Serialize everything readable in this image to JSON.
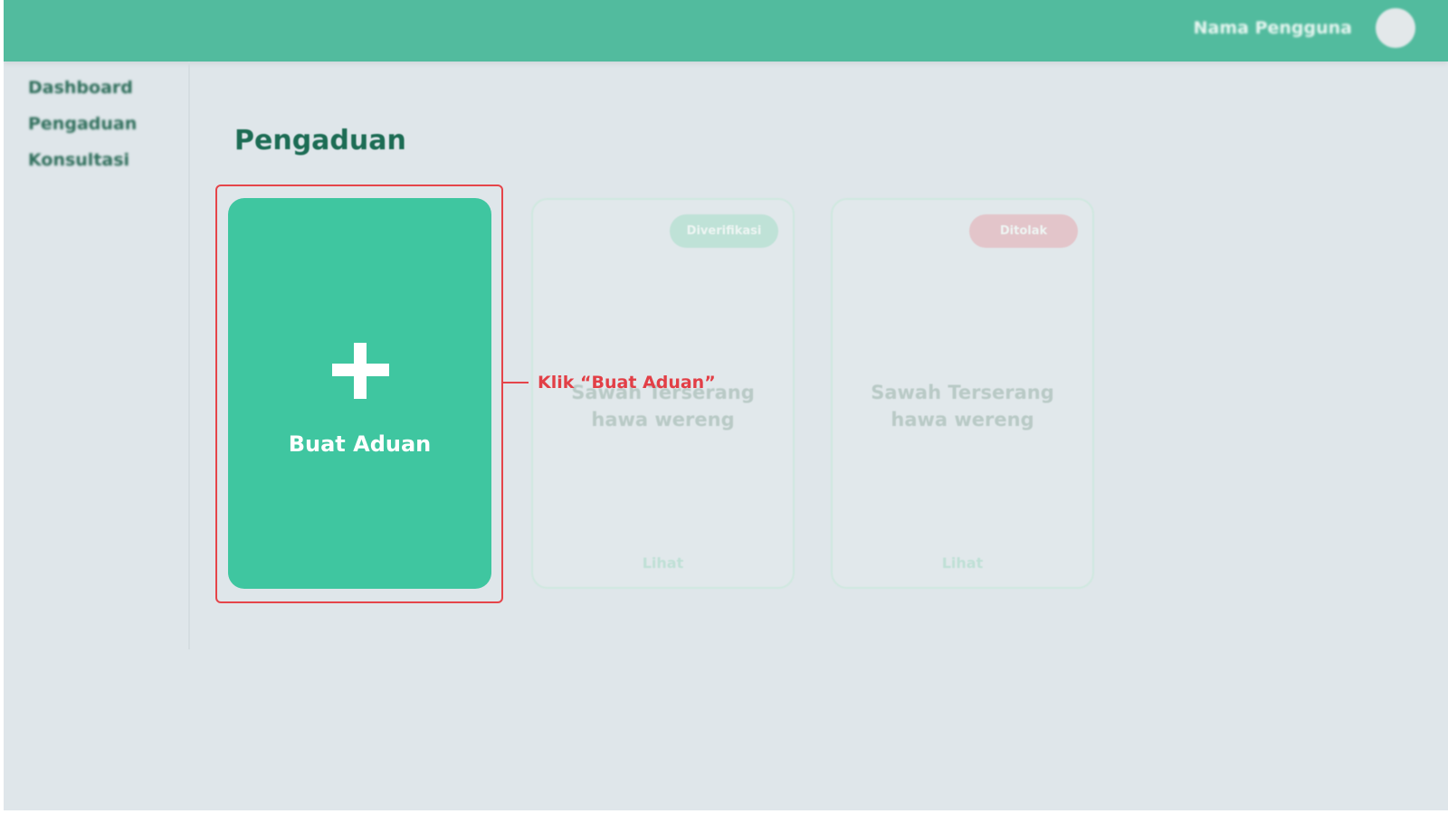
{
  "header": {
    "user_name": "Nama Pengguna",
    "avatar_icon": "user-avatar-icon"
  },
  "sidebar": {
    "items": [
      {
        "label": "Dashboard"
      },
      {
        "label": "Pengaduan"
      },
      {
        "label": "Konsultasi"
      }
    ]
  },
  "main": {
    "title": "Pengaduan",
    "create_card": {
      "icon": "plus-icon",
      "label": "Buat Aduan"
    },
    "annotation": "Klik “Buat Aduan”",
    "cards": [
      {
        "status": "Diverifikasi",
        "status_color": "#bfe2d7",
        "title_line1": "Sawah Terserang",
        "title_line2": "hawa wereng",
        "link": "Lihat"
      },
      {
        "status": "Ditolak",
        "status_color": "#e3c5ca",
        "title_line1": "Sawah Terserang",
        "title_line2": "hawa wereng",
        "link": "Lihat"
      }
    ]
  },
  "colors": {
    "brand": "#52bb9e",
    "accent": "#3fc6a0",
    "annotation": "#e5454a"
  }
}
